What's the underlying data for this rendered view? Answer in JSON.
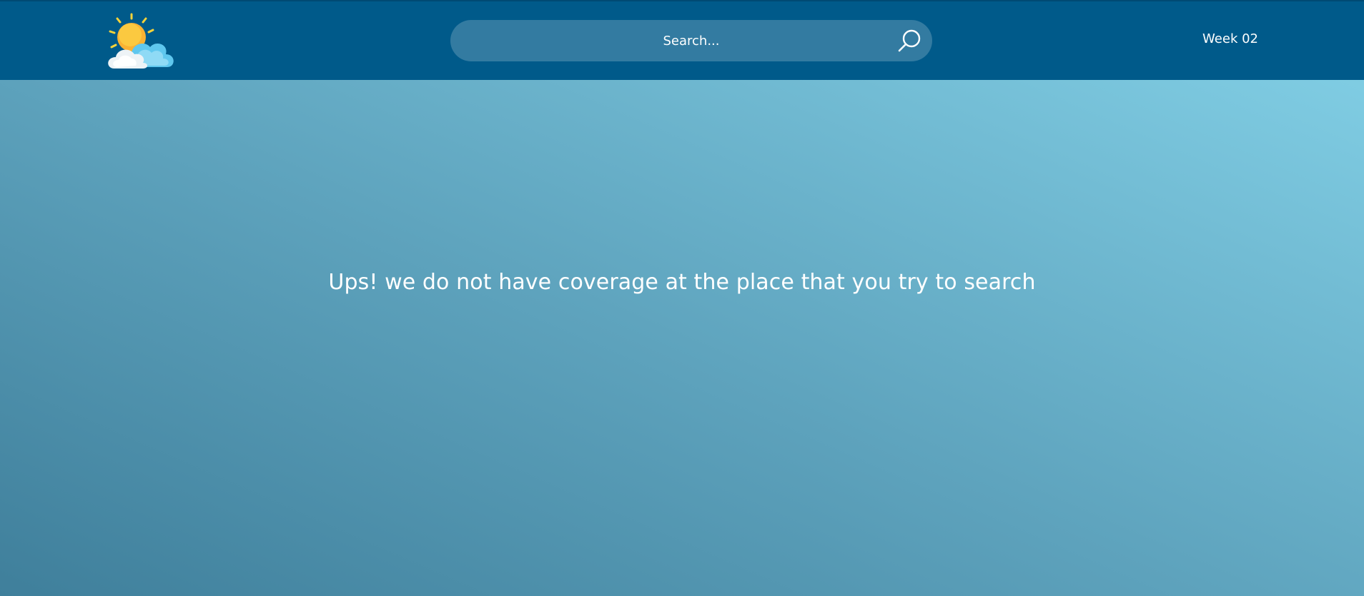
{
  "header": {
    "logo_icon": "sun-behind-cloud-icon",
    "search": {
      "placeholder": "Search...",
      "value": "",
      "button_icon": "search-icon"
    },
    "week_label": "Week 02"
  },
  "main": {
    "message": "Ups! we do not have coverage at the place that you try to search"
  },
  "colors": {
    "header_bg": "#005a8a",
    "gradient_start": "#3f7f9b",
    "gradient_end": "#84d2e8",
    "text": "#ffffff"
  }
}
